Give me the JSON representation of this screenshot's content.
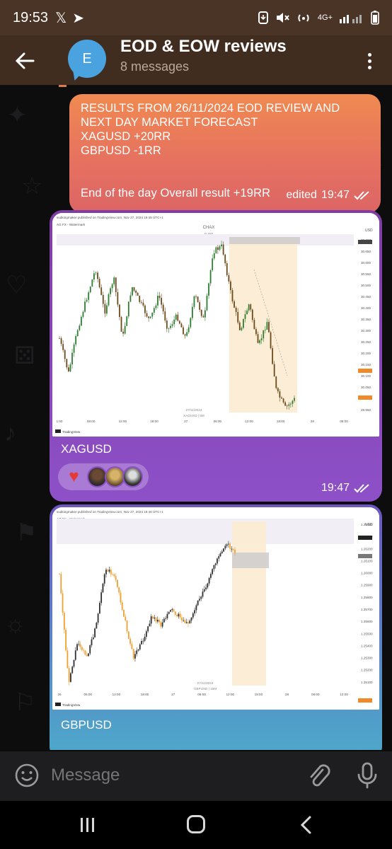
{
  "status_bar": {
    "time": "19:53",
    "x_icon": "𝕏",
    "telegram_icon": "➤",
    "network": "4G+"
  },
  "header": {
    "avatar_letter": "E",
    "title": "EOD & EOW reviews",
    "subtitle": "8 messages"
  },
  "messages": [
    {
      "type": "text",
      "lines": [
        "RESULTS FROM 26/11/2024 EOD REVIEW AND NEXT DAY MARKET FORECAST",
        "XAGUSD +20RR",
        "GBPUSD -1RR"
      ],
      "overall": "End of the day Overall result +19RR",
      "edited": "edited",
      "time": "19:47"
    },
    {
      "type": "media",
      "caption": "XAGUSD",
      "time": "19:47",
      "reaction_emoji": "♥",
      "chart": {
        "header_text": "sudkingmaker published on TradingView.com, Nov 27, 2024 19:45 UTC+1",
        "sub_text": "AG FX - Watermark",
        "watermark_line1": "CHAX",
        "watermark_line2": "SLIRE",
        "footer_date": "27/11/2024",
        "footer_symbol": "XAGUSD | 5M",
        "brand": "TradingView",
        "currency": "USD",
        "x_ticks": [
          "1:00",
          "06:00",
          "12:00",
          "18:00",
          "27",
          "06:00",
          "12:00",
          "18:00",
          "28",
          "06:00"
        ],
        "y_ticks": [
          "30.693",
          "30.650",
          "30.600",
          "30.550",
          "30.500",
          "30.450",
          "30.400",
          "30.350",
          "30.300",
          "30.250",
          "30.200",
          "30.150",
          "30.100",
          "30.050",
          "30.000",
          "29.950"
        ]
      }
    },
    {
      "type": "media",
      "caption": "GBPUSD",
      "chart": {
        "header_text": "sudkingmaker published on TradingView.com, Nov 27, 2024 19:46 UTC+1",
        "sub_text": "AG FX - Watermark",
        "watermark_line1": "CHAX",
        "watermark_line2": "SLIRE",
        "footer_date": "27/11/2024",
        "footer_symbol": "GBPUSD | 15M",
        "brand": "TradingView",
        "currency": "USD",
        "x_ticks": [
          "26",
          "06:00",
          "12:00",
          "18:00",
          "27",
          "06:00",
          "12:00",
          "18:00",
          "28",
          "06:00",
          "12:00"
        ],
        "y_ticks": [
          "1.26400",
          "1.26300",
          "1.26200",
          "1.26100",
          "1.26000",
          "1.25900",
          "1.25800",
          "1.25700",
          "1.25600",
          "1.25500",
          "1.25400",
          "1.25300",
          "1.25200",
          "1.25100"
        ]
      }
    }
  ],
  "input": {
    "placeholder": "Message"
  },
  "colors": {
    "header_bg": "#412c20",
    "text_bubble_top": "#f08a51",
    "text_bubble_bottom": "#dc6565",
    "media_bubble_purple": "#8e50c8",
    "media_bubble_teal": "#4caacb"
  }
}
